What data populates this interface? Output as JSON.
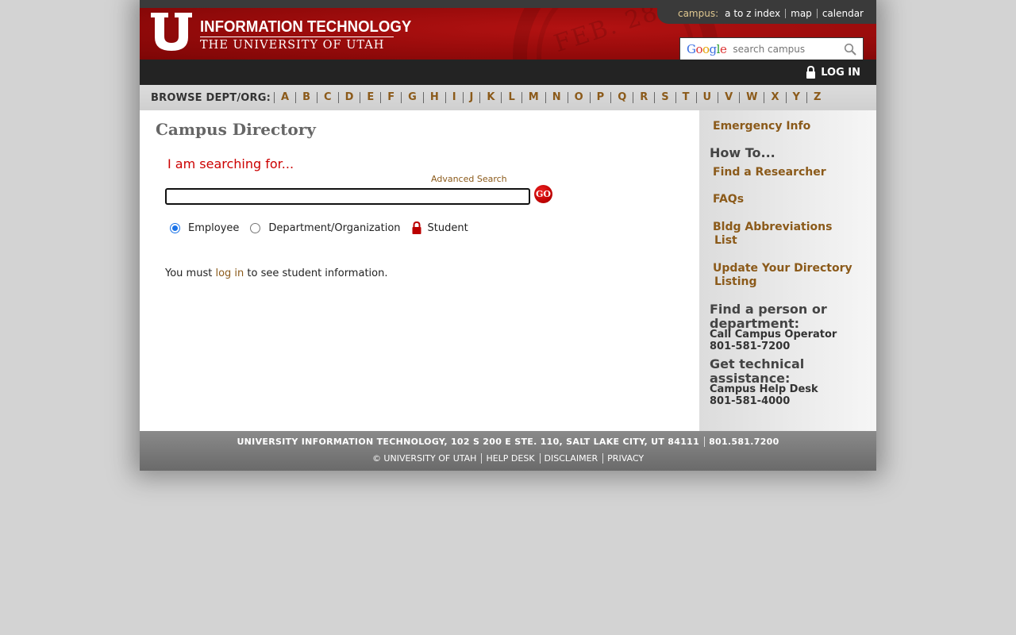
{
  "header": {
    "logo_line1": "INFORMATION TECHNOLOGY",
    "logo_line2": "THE UNIVERSITY OF UTAH",
    "campus_label": "campus:",
    "campus_links": [
      "a to z index",
      "map",
      "calendar"
    ],
    "search_brand": "Google",
    "search_placeholder": "search campus",
    "login_label": "LOG IN"
  },
  "browse": {
    "label": "BROWSE DEPT/ORG:",
    "letters": [
      "A",
      "B",
      "C",
      "D",
      "E",
      "F",
      "G",
      "H",
      "I",
      "J",
      "K",
      "L",
      "M",
      "N",
      "O",
      "P",
      "Q",
      "R",
      "S",
      "T",
      "U",
      "V",
      "W",
      "X",
      "Y",
      "Z"
    ]
  },
  "main": {
    "title": "Campus Directory",
    "searching_for": "I am searching for...",
    "advanced_search": "Advanced Search",
    "search_value": "",
    "go_label": "GO",
    "radio_employee": "Employee",
    "radio_department": "Department/Organization",
    "radio_student": "Student",
    "login_prefix": "You must ",
    "login_link": "log in",
    "login_suffix": " to see student information."
  },
  "sidebar": {
    "emergency": "Emergency Info",
    "how_to": "How To...",
    "find_researcher": "Find a Researcher",
    "faqs": "FAQs",
    "bldg_line1": "Bldg Abbreviations",
    "bldg_line2": "List",
    "update_line1": "Update Your Directory",
    "update_line2": "Listing",
    "find_head_line1": "Find a person or",
    "find_head_line2": "department:",
    "operator_label": "Call Campus Operator",
    "operator_phone": "801-581-7200",
    "tech_head_line1": "Get technical",
    "tech_head_line2": "assistance:",
    "helpdesk_label": "Campus Help Desk",
    "helpdesk_phone": "801-581-4000"
  },
  "footer": {
    "address": "UNIVERSITY INFORMATION TECHNOLOGY, 102 S 200 E STE. 110, SALT LAKE CITY, UT 84111",
    "phone": "801.581.7200",
    "copyright": "© UNIVERSITY OF UTAH",
    "links": [
      "HELP DESK",
      "DISCLAIMER",
      "PRIVACY"
    ]
  },
  "colors": {
    "brand_red": "#9c0c0c",
    "link_brown": "#8b5a1a",
    "alert_red": "#cc0000"
  }
}
